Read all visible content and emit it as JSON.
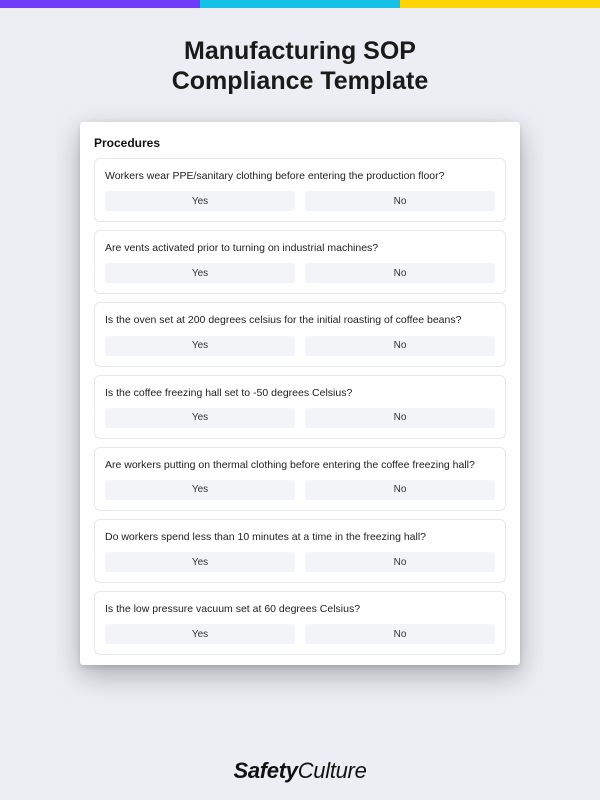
{
  "colors": {
    "purple": "#6f3cff",
    "cyan": "#15c1e6",
    "yellow": "#ffd500"
  },
  "title_line1": "Manufacturing SOP",
  "title_line2": "Compliance Template",
  "section_title": "Procedures",
  "answers": {
    "yes": "Yes",
    "no": "No"
  },
  "questions": [
    {
      "text": "Workers wear PPE/sanitary clothing before entering the production floor?"
    },
    {
      "text": "Are vents activated prior to turning on industrial machines?"
    },
    {
      "text": "Is the oven set at 200 degrees celsius for the initial roasting of coffee beans?"
    },
    {
      "text": "Is the coffee freezing hall set to -50 degrees Celsius?"
    },
    {
      "text": "Are workers putting on thermal clothing before entering the coffee freezing hall?"
    },
    {
      "text": "Do workers spend less than 10 minutes at a time in the freezing hall?"
    },
    {
      "text": "Is the low pressure vacuum set at 60 degrees Celsius?"
    }
  ],
  "brand": {
    "bold": "Safety",
    "light": "Culture"
  }
}
